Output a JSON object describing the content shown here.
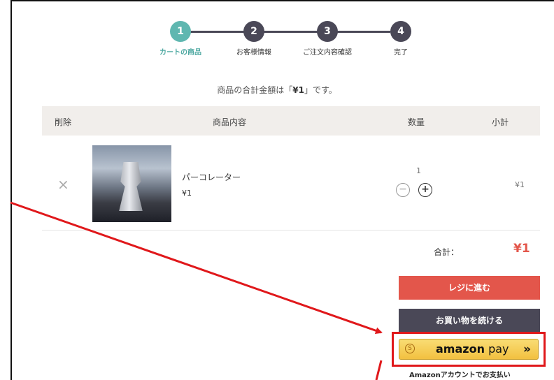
{
  "steps": [
    {
      "num": "1",
      "label": "カートの商品"
    },
    {
      "num": "2",
      "label": "お客様情報"
    },
    {
      "num": "3",
      "label": "ご注文内容確認"
    },
    {
      "num": "4",
      "label": "完了"
    }
  ],
  "total_message": {
    "prefix": "商品の合計金額は「",
    "amount": "¥1",
    "suffix": "」です。"
  },
  "table_header": {
    "delete": "削除",
    "contents": "商品内容",
    "quantity": "数量",
    "subtotal": "小計"
  },
  "item": {
    "remove_icon": "×",
    "name": "パーコレーター",
    "price": "¥1",
    "quantity": "1",
    "minus": "−",
    "plus": "+",
    "subtotal": "¥1"
  },
  "summary": {
    "label": "合計：",
    "value": "¥1"
  },
  "buttons": {
    "checkout": "レジに進む",
    "continue": "お買い物を続ける"
  },
  "amazon": {
    "logo_text": "amazon",
    "pay": "pay",
    "chevron": "»",
    "note": "Amazonアカウントでお支払い"
  },
  "colors": {
    "accent": "#5fb7b0",
    "dark": "#4a4857",
    "red": "#e3564b",
    "annotation": "#e0181b"
  }
}
